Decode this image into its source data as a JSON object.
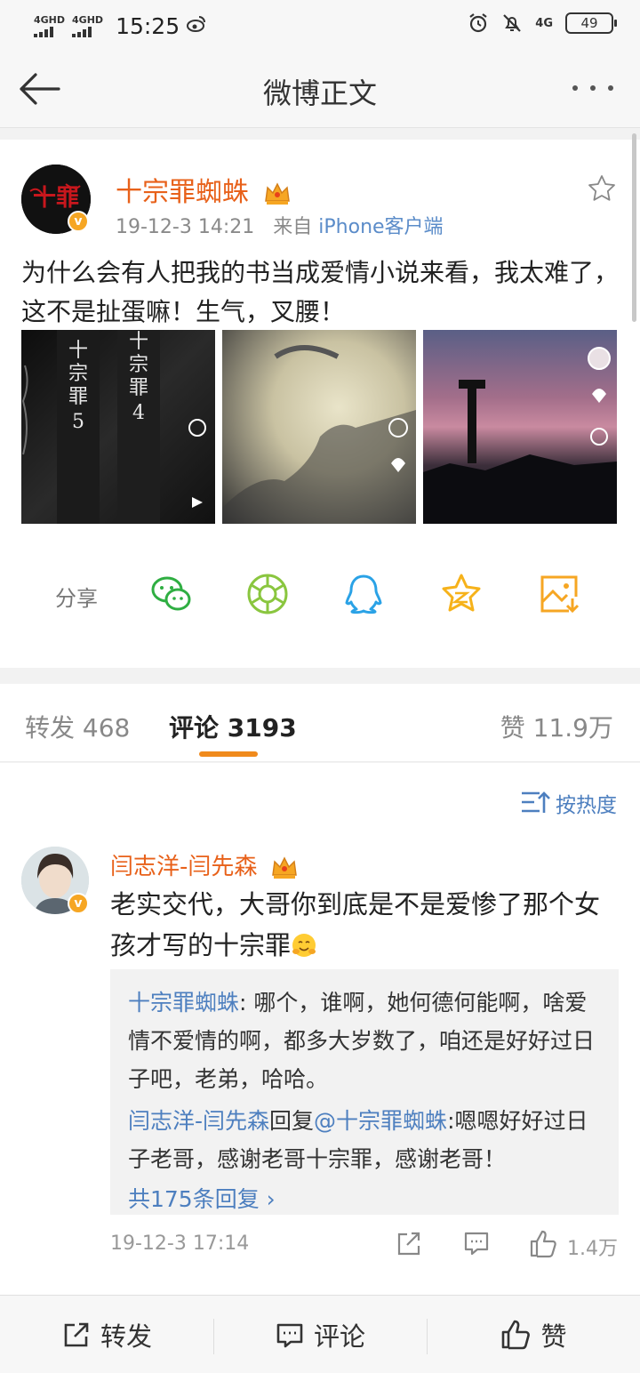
{
  "status": {
    "signal_left": "4GHD",
    "signal_right": "4GHD",
    "time": "15:25",
    "network": "4G",
    "battery": "49"
  },
  "header": {
    "title": "微博正文"
  },
  "post": {
    "username": "十宗罪蜘蛛",
    "date": "19-12-3 14:21",
    "source_prefix": "来自",
    "source": "iPhone客户端",
    "content": "为什么会有人把我的书当成爱情小说来看，我太难了，这不是扯蛋嘛！生气，叉腰！",
    "share_label": "分享",
    "share_targets": [
      "wechat-icon",
      "moments-icon",
      "qq-icon",
      "qzone-icon",
      "save-image-icon"
    ]
  },
  "tabs": [
    {
      "label": "转发",
      "count": "468"
    },
    {
      "label": "评论",
      "count": "3193"
    },
    {
      "label": "赞",
      "count": "11.9万"
    }
  ],
  "comments": {
    "sort_label": "按热度",
    "items": [
      {
        "name": "闫志洋-闫先森",
        "text": "老实交代，大哥你到底是不是爱惨了那个女孩才写的十宗罪",
        "replies": [
          {
            "name": "十宗罪蜘蛛",
            "sep": ":",
            "text": " 哪个，谁啊，她何德何能啊，啥爱情不爱情的啊，都多大岁数了，咱还是好好过日子吧，老弟，哈哈。"
          },
          {
            "name": "闫志洋-闫先森",
            "mid": "回复",
            "mention": "@十宗罪蜘蛛",
            "sep": ":",
            "text": "嗯嗯好好过日子老哥，感谢老哥十宗罪，感谢老哥！"
          }
        ],
        "more_replies": "共175条回复 ›",
        "date": "19-12-3 17:14",
        "likes": "1.4万"
      }
    ]
  },
  "bottom_bar": {
    "repost": "转发",
    "comment": "评论",
    "like": "赞"
  },
  "colors": {
    "accent_orange": "#e8611a",
    "link_blue": "#4d7fbf",
    "tab_underline": "#f08a1c"
  }
}
